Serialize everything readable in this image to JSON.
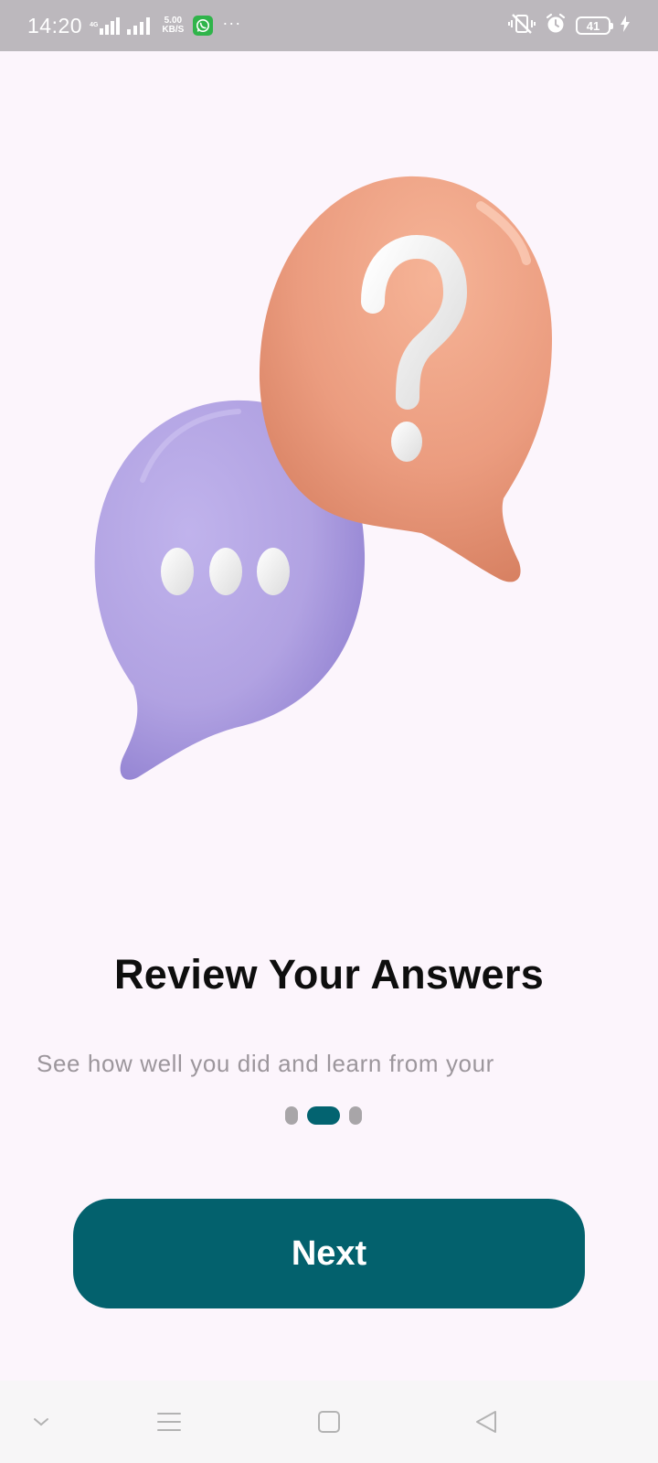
{
  "status_bar": {
    "time": "14:20",
    "signal_label": "4G",
    "net_speed_value": "5.00",
    "net_speed_unit": "KB/S",
    "more_dots": "···",
    "battery": "41"
  },
  "illustration": {
    "left_bubble_color": "#b3a4e4",
    "right_bubble_color": "#eb9c7f"
  },
  "onboarding": {
    "title": "Review Your Answers",
    "subtitle": "See how well you did and learn from your",
    "page_indicator": {
      "total": 3,
      "active": 2
    },
    "next_label": "Next"
  },
  "colors": {
    "primary": "#03616d",
    "background": "#fcf5fc"
  },
  "nav_bar": {
    "icons": [
      "chevron-down-icon",
      "menu-icon",
      "home-square-icon",
      "back-triangle-icon"
    ]
  }
}
